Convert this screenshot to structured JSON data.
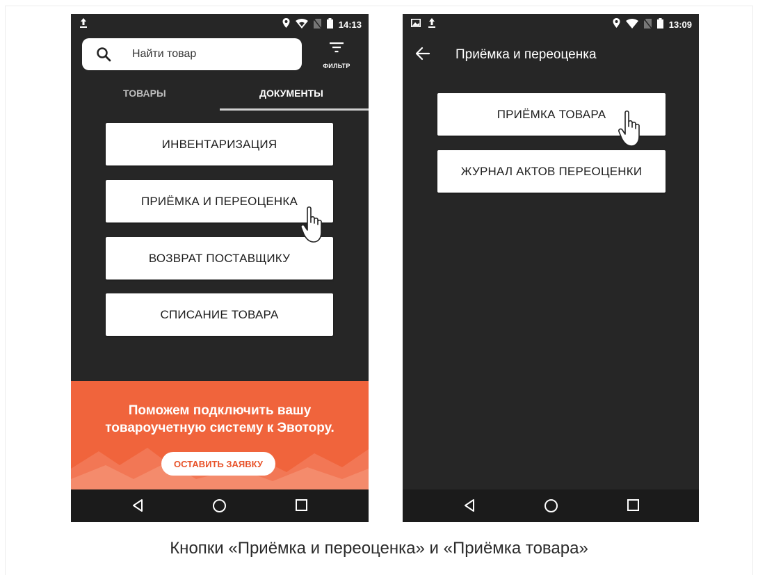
{
  "left_screen": {
    "status_time": "14:13",
    "search_placeholder": "Найти товар",
    "filter_label": "ФИЛЬТР",
    "tabs": [
      {
        "label": "ТОВАРЫ",
        "active": false
      },
      {
        "label": "ДОКУМЕНТЫ",
        "active": true
      }
    ],
    "buttons": [
      {
        "label": "ИНВЕНТАРИЗАЦИЯ"
      },
      {
        "label": "ПРИЁМКА И ПЕРЕОЦЕНКА"
      },
      {
        "label": "ВОЗВРАТ ПОСТАВЩИКУ"
      },
      {
        "label": "СПИСАНИЕ ТОВАРА"
      }
    ],
    "promo": {
      "line1": "Поможем подключить вашу",
      "line2": "товароучетную систему к Эвотору.",
      "button": "ОСТАВИТЬ ЗАЯВКУ"
    }
  },
  "right_screen": {
    "status_time": "13:09",
    "title": "Приёмка и переоценка",
    "buttons": [
      {
        "label": "ПРИЁМКА ТОВАРА"
      },
      {
        "label": "ЖУРНАЛ АКТОВ ПЕРЕОЦЕНКИ"
      }
    ]
  },
  "caption": "Кнопки «Приёмка и переоценка» и «Приёмка товара»",
  "colors": {
    "screen_bg": "#262626",
    "promo_bg": "#f0643c",
    "navbar_bg": "#1b1b1b",
    "button_bg": "#ffffff"
  },
  "icons": [
    "upload-icon",
    "image-icon",
    "location-icon",
    "wifi-icon",
    "no-sim-icon",
    "battery-icon",
    "search-icon",
    "filter-icon",
    "back-arrow-icon",
    "nav-back-icon",
    "nav-home-icon",
    "nav-recents-icon",
    "pointer-hand-icon"
  ]
}
